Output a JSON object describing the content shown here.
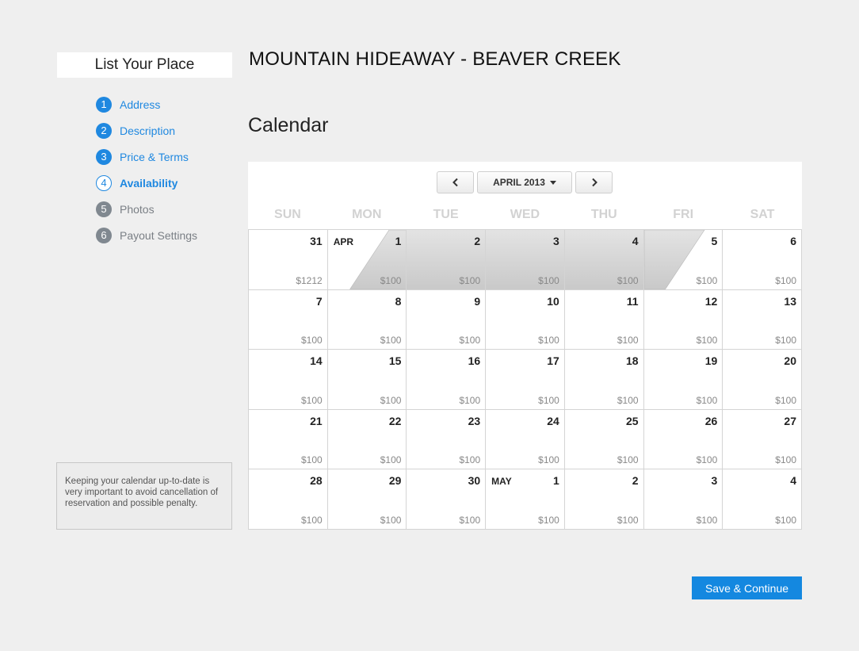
{
  "sidebar": {
    "title": "List Your Place",
    "steps": [
      {
        "num": "1",
        "label": "Address",
        "state": "done"
      },
      {
        "num": "2",
        "label": "Description",
        "state": "done"
      },
      {
        "num": "3",
        "label": "Price & Terms",
        "state": "done"
      },
      {
        "num": "4",
        "label": "Availability",
        "state": "current"
      },
      {
        "num": "5",
        "label": "Photos",
        "state": "future"
      },
      {
        "num": "6",
        "label": "Payout Settings",
        "state": "future"
      }
    ],
    "note": "Keeping your calendar up-to-date is very important to avoid cancellation of reservation and possible penalty."
  },
  "main": {
    "title": "MOUNTAIN HIDEAWAY - BEAVER CREEK",
    "section_title": "Calendar",
    "save_label": "Save & Continue"
  },
  "calendar": {
    "month_label": "APRIL 2013",
    "prev_icon": "chevron-left-icon",
    "next_icon": "chevron-right-icon",
    "weekdays": [
      "SUN",
      "MON",
      "TUE",
      "WED",
      "THU",
      "FRI",
      "SAT"
    ],
    "booked_color": "#c9c9c9",
    "weeks": [
      [
        {
          "day": "31",
          "price": "$1212"
        },
        {
          "day": "1",
          "month": "APR",
          "price": "$100",
          "booking": "start"
        },
        {
          "day": "2",
          "price": "$100",
          "booking": "full"
        },
        {
          "day": "3",
          "price": "$100",
          "booking": "full"
        },
        {
          "day": "4",
          "price": "$100",
          "booking": "full"
        },
        {
          "day": "5",
          "price": "$100",
          "booking": "end"
        },
        {
          "day": "6",
          "price": "$100"
        }
      ],
      [
        {
          "day": "7",
          "price": "$100"
        },
        {
          "day": "8",
          "price": "$100"
        },
        {
          "day": "9",
          "price": "$100"
        },
        {
          "day": "10",
          "price": "$100"
        },
        {
          "day": "11",
          "price": "$100"
        },
        {
          "day": "12",
          "price": "$100"
        },
        {
          "day": "13",
          "price": "$100"
        }
      ],
      [
        {
          "day": "14",
          "price": "$100"
        },
        {
          "day": "15",
          "price": "$100"
        },
        {
          "day": "16",
          "price": "$100"
        },
        {
          "day": "17",
          "price": "$100"
        },
        {
          "day": "18",
          "price": "$100"
        },
        {
          "day": "19",
          "price": "$100"
        },
        {
          "day": "20",
          "price": "$100"
        }
      ],
      [
        {
          "day": "21",
          "price": "$100"
        },
        {
          "day": "22",
          "price": "$100"
        },
        {
          "day": "23",
          "price": "$100"
        },
        {
          "day": "24",
          "price": "$100"
        },
        {
          "day": "25",
          "price": "$100"
        },
        {
          "day": "26",
          "price": "$100"
        },
        {
          "day": "27",
          "price": "$100"
        }
      ],
      [
        {
          "day": "28",
          "price": "$100"
        },
        {
          "day": "29",
          "price": "$100"
        },
        {
          "day": "30",
          "price": "$100"
        },
        {
          "day": "1",
          "month": "MAY",
          "price": "$100"
        },
        {
          "day": "2",
          "price": "$100"
        },
        {
          "day": "3",
          "price": "$100"
        },
        {
          "day": "4",
          "price": "$100"
        }
      ]
    ]
  }
}
